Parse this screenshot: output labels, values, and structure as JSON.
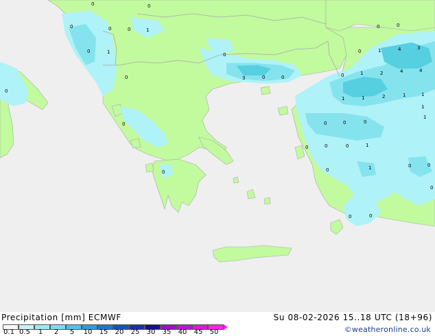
{
  "map": {
    "colors": {
      "sea": "#efefef",
      "land": "#c2fa9e",
      "border": "#a9a9a9",
      "precip_0_1": "#aff2f7",
      "precip_0_5": "#85e3ee",
      "precip_1": "#56cfe0",
      "precip_2": "#2fb1d6"
    },
    "values": [
      "0",
      "0",
      "0",
      "0",
      "0",
      "1",
      "0",
      "1",
      "0",
      "0",
      "0",
      "0",
      "1",
      "4",
      "3",
      "0",
      "1",
      "2",
      "4",
      "4",
      "0",
      "3",
      "0",
      "0",
      "0",
      "1",
      "1",
      "1",
      "2",
      "1",
      "1",
      "1",
      "0",
      "0",
      "0",
      "0",
      "0",
      "1",
      "0",
      "0",
      "1",
      "0",
      "0",
      "0",
      "0",
      "0",
      "0",
      "0"
    ]
  },
  "footer": {
    "title": "Precipitation [mm]  ECMWF",
    "datetime": "Su 08-02-2026 15..18 UTC (18+96)",
    "credit": "©weatheronline.co.uk",
    "scale_labels": [
      "0.1",
      "0.5",
      "1",
      "2",
      "5",
      "10",
      "15",
      "20",
      "25",
      "30",
      "35",
      "40",
      "45",
      "50"
    ],
    "scale_colors": [
      "#f5fafa",
      "#c9f0f5",
      "#a0e7f0",
      "#78dced",
      "#4fc2e6",
      "#2f9ddc",
      "#2672d2",
      "#1f4ec4",
      "#1a2fb2",
      "#170f99",
      "#9b0fd2",
      "#bd14de",
      "#dc18e0",
      "#ff20ee"
    ]
  }
}
